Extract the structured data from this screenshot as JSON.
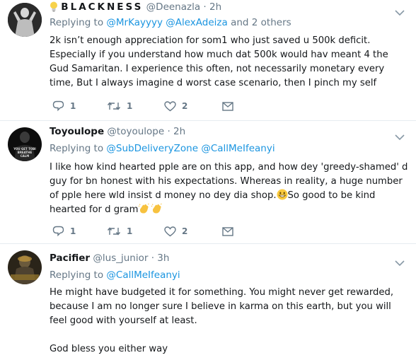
{
  "tweets": [
    {
      "name": "BLACKNESS",
      "handle": "@Deenazla",
      "dot": "·",
      "time": "2h",
      "replying_prefix": "Replying to",
      "mentions": [
        "@MrKayyyy",
        "@AlexAdeiza"
      ],
      "replying_suffix": "and 2 others",
      "text": "2k isn’t enough appreciation for som1 who just saved u 500k deficit. Especially if you understand how much dat 500k would hav meant 4 the Gud Samaritan. I experience this often, not necessarily monetary every time, But I always imagine d worst case scenario, then I pinch my self",
      "reply_count": "1",
      "retweet_count": "1",
      "like_count": "2"
    },
    {
      "name": "Toyoulope",
      "handle": "@toyoulope",
      "dot": "·",
      "time": "2h",
      "replying_prefix": "Replying to",
      "mentions": [
        "@SubDeliveryZone",
        "@CallMeIfeanyi"
      ],
      "text_part1": "I like how kind hearted pple are on this app, and how dey 'greedy-shamed' d guy for bn honest with his expectations. Whereas in reality, a huge number of pple here wld insist d money no dey dia shop.",
      "text_part2": "So good to be kind hearted for d gram",
      "avatar_text_1": "YOU GET TOBI",
      "avatar_text_2": "BREATHE",
      "avatar_text_3": "CALM",
      "reply_count": "1",
      "retweet_count": "1",
      "like_count": "2"
    },
    {
      "name": "Pacifier",
      "handle": "@lus_junior",
      "dot": "·",
      "time": "3h",
      "replying_prefix": "Replying to",
      "mentions": [
        "@CallMeIfeanyi"
      ],
      "text": "He might have budgeted it for something. You might never get rewarded, because I am no longer sure I believe in karma on this earth, but you will feel good with yourself at least.",
      "text_2": "God bless you either way"
    }
  ],
  "colors": {
    "link": "#1b95e0",
    "muted": "#657786",
    "text": "#14171a",
    "divider": "#e6ecf0"
  },
  "icons": {
    "reply": "reply-icon",
    "retweet": "retweet-icon",
    "like": "heart-icon",
    "dm": "envelope-icon",
    "caret": "chevron-down-icon",
    "verified_prefix": "lightbulb-emoji",
    "emoji_grin": "grinning-face-emoji",
    "emoji_clap": "clapping-hands-emoji"
  }
}
